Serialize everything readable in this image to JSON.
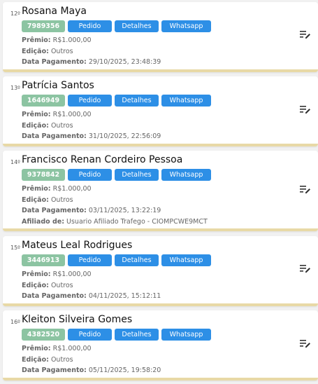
{
  "ui": {
    "pedido_label": "Pedido",
    "detalhes_label": "Detalhes",
    "whatsapp_label": "Whatsapp",
    "premio_label": "Prêmio:",
    "edicao_label": "Edição:",
    "data_label": "Data Pagamento:",
    "afiliado_label": "Afiliado de:"
  },
  "entries": [
    {
      "rank": "12º",
      "name": "Rosana Maya",
      "code": "7989356",
      "premio": "R$1.000,00",
      "edicao": "Outros",
      "data": "29/10/2025, 23:48:39"
    },
    {
      "rank": "13º",
      "name": "Patrícia Santos",
      "code": "1646949",
      "premio": "R$1.000,00",
      "edicao": "Outros",
      "data": "31/10/2025, 22:56:09"
    },
    {
      "rank": "14º",
      "name": "Francisco Renan Cordeiro Pessoa",
      "code": "9378842",
      "premio": "R$1.000,00",
      "edicao": "Outros",
      "data": "03/11/2025, 13:22:19",
      "afiliado": "Usuario Afiliado Trafego - CIOMPCWE9MCT"
    },
    {
      "rank": "15º",
      "name": "Mateus Leal Rodrigues",
      "code": "3446913",
      "premio": "R$1.000,00",
      "edicao": "Outros",
      "data": "04/11/2025, 15:12:11"
    },
    {
      "rank": "16º",
      "name": "Kleiton Silveira Gomes",
      "code": "4382520",
      "premio": "R$1.000,00",
      "edicao": "Outros",
      "data": "05/11/2025, 19:58:20"
    }
  ],
  "colors": {
    "code_badge": "#8cc4a2",
    "button": "#2d8fe6",
    "card_border": "#e8d9a6"
  }
}
